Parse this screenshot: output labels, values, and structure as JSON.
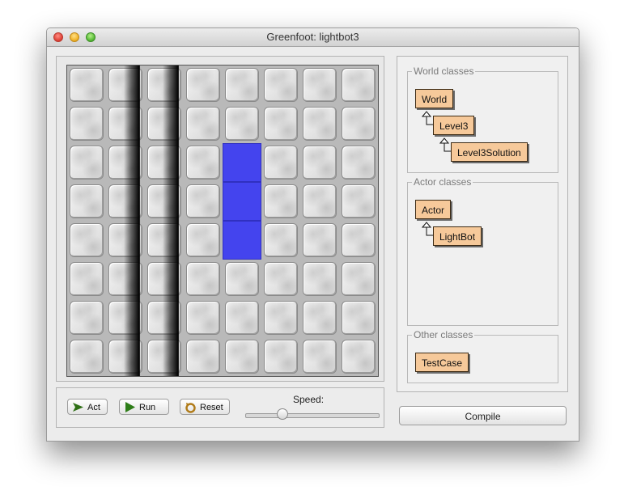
{
  "window": {
    "title": "Greenfoot: lightbot3"
  },
  "world": {
    "columns": 8,
    "rows": 8,
    "lit_cells": [
      [
        4,
        2
      ],
      [
        4,
        3
      ],
      [
        4,
        4
      ]
    ],
    "shadow_columns": [
      2,
      3
    ],
    "lit_color": "#4444ee"
  },
  "controls": {
    "act": "Act",
    "run": "Run",
    "reset": "Reset",
    "speed_label": "Speed:",
    "speed_value": 0.25
  },
  "classes": {
    "world_legend": "World classes",
    "world_items": [
      "World",
      "Level3",
      "Level3Solution"
    ],
    "actor_legend": "Actor classes",
    "actor_items": [
      "Actor",
      "LightBot"
    ],
    "other_legend": "Other classes",
    "other_items": [
      "TestCase"
    ],
    "class_color": "#f6c99a"
  },
  "compile": "Compile"
}
